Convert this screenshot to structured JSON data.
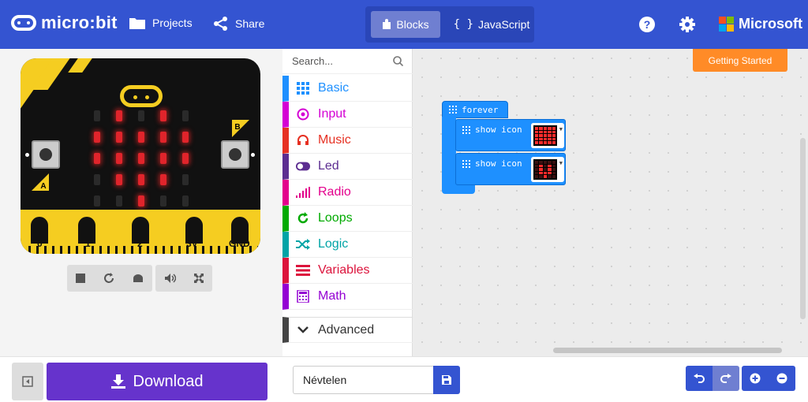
{
  "header": {
    "brand": "micro:bit",
    "projects_label": "Projects",
    "share_label": "Share",
    "tabs": [
      {
        "label": "Blocks",
        "active": true
      },
      {
        "label": "JavaScript",
        "active": false
      }
    ],
    "microsoft_label": "Microsoft"
  },
  "simulator": {
    "button_a": "A",
    "button_b": "B",
    "pins": [
      "0",
      "1",
      "2",
      "3V",
      "GND"
    ],
    "led_matrix": [
      [
        0,
        1,
        0,
        1,
        0
      ],
      [
        1,
        1,
        1,
        1,
        1
      ],
      [
        1,
        1,
        1,
        1,
        1
      ],
      [
        0,
        1,
        1,
        1,
        0
      ],
      [
        0,
        0,
        1,
        0,
        0
      ]
    ],
    "controls": [
      "stop-icon",
      "restart-icon",
      "slow-motion-icon",
      "sound-icon",
      "fullscreen-icon"
    ]
  },
  "toolbox": {
    "search_placeholder": "Search...",
    "categories": [
      {
        "label": "Basic",
        "color": "#1E90FF",
        "icon": "grid-icon"
      },
      {
        "label": "Input",
        "color": "#D400D4",
        "icon": "target-icon"
      },
      {
        "label": "Music",
        "color": "#E63022",
        "icon": "headphones-icon"
      },
      {
        "label": "Led",
        "color": "#5C2D91",
        "icon": "toggle-icon"
      },
      {
        "label": "Radio",
        "color": "#E3008C",
        "icon": "signal-icon"
      },
      {
        "label": "Loops",
        "color": "#00AA00",
        "icon": "refresh-icon"
      },
      {
        "label": "Logic",
        "color": "#00A4A6",
        "icon": "shuffle-icon"
      },
      {
        "label": "Variables",
        "color": "#DC143C",
        "icon": "lines-icon"
      },
      {
        "label": "Math",
        "color": "#9400D3",
        "icon": "calculator-icon"
      }
    ],
    "advanced_label": "Advanced"
  },
  "workspace": {
    "getting_started": "Getting Started",
    "forever_label": "forever",
    "show_icon_label": "show icon",
    "icon1": [
      [
        1,
        1,
        1,
        1,
        1
      ],
      [
        1,
        1,
        1,
        1,
        1
      ],
      [
        1,
        1,
        1,
        1,
        1
      ],
      [
        1,
        1,
        1,
        1,
        1
      ],
      [
        1,
        1,
        1,
        1,
        1
      ]
    ],
    "icon2": [
      [
        0,
        0,
        0,
        0,
        0
      ],
      [
        0,
        1,
        0,
        1,
        0
      ],
      [
        0,
        1,
        0,
        1,
        0
      ],
      [
        0,
        1,
        1,
        1,
        0
      ],
      [
        0,
        0,
        1,
        0,
        0
      ]
    ]
  },
  "bottom": {
    "download_label": "Download",
    "project_name": "Névtelen"
  }
}
